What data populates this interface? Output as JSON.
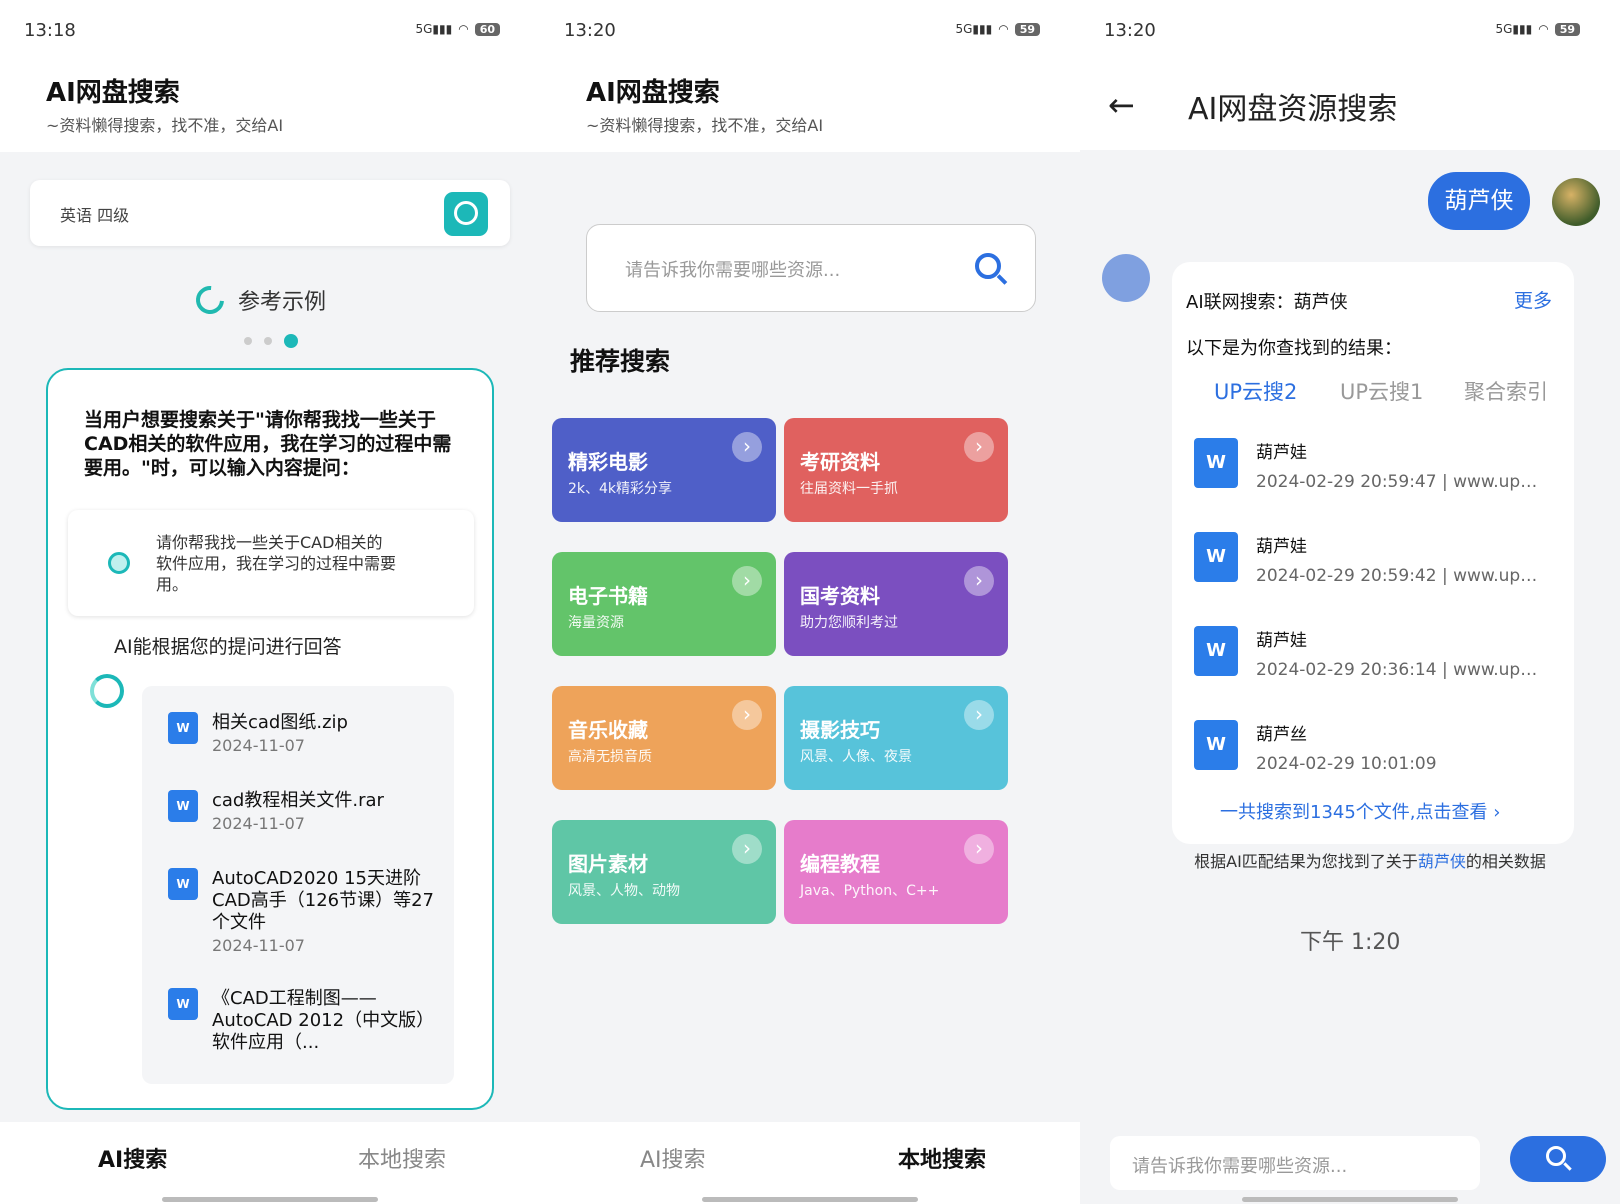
{
  "panel1": {
    "status_time": "13:18",
    "battery": "60",
    "app_title": "AI网盘搜索",
    "app_subtitle": "~资料懒得搜索，找不准，交给AI",
    "search_value": "英语 四级",
    "example_title": "参考示例",
    "intro": "当用户想要搜索关于\"请你帮我找一些关于CAD相关的软件应用，我在学习的过程中需要用。\"时，可以输入内容提问：",
    "prompt": "请你帮我找一些关于CAD相关的软件应用，我在学习的过程中需要用。",
    "ai_answer_label": "AI能根据您的提问进行回答",
    "files": [
      {
        "name": "相关cad图纸.zip",
        "date": "2024-11-07"
      },
      {
        "name": "cad教程相关文件.rar",
        "date": "2024-11-07"
      },
      {
        "name": "AutoCAD2020 15天进阶CAD高手（126节课）等27 个文件",
        "date": "2024-11-07"
      },
      {
        "name": "《CAD工程制图——AutoCAD 2012（中文版）软件应用（...",
        "date": ""
      }
    ],
    "tab_ai": "AI搜索",
    "tab_local": "本地搜索"
  },
  "panel2": {
    "status_time": "13:20",
    "battery": "59",
    "app_title": "AI网盘搜索",
    "app_subtitle": "~资料懒得搜索，找不准，交给AI",
    "search_placeholder": "请告诉我你需要哪些资源...",
    "rec_title": "推荐搜索",
    "tiles": [
      {
        "title": "精彩电影",
        "sub": "2k、4k精彩分享",
        "color": "#4f5fc8"
      },
      {
        "title": "考研资料",
        "sub": "往届资料一手抓",
        "color": "#e0615f"
      },
      {
        "title": "电子书籍",
        "sub": "海量资源",
        "color": "#63c46a"
      },
      {
        "title": "国考资料",
        "sub": "助力您顺利考过",
        "color": "#7b4fc0"
      },
      {
        "title": "音乐收藏",
        "sub": "高清无损音质",
        "color": "#eea35a"
      },
      {
        "title": "摄影技巧",
        "sub": "风景、人像、夜景",
        "color": "#57c3da"
      },
      {
        "title": "图片素材",
        "sub": "风景、人物、动物",
        "color": "#5fc6a6"
      },
      {
        "title": "编程教程",
        "sub": "Java、Python、C++",
        "color": "#e67ccb"
      }
    ],
    "tab_ai": "AI搜索",
    "tab_local": "本地搜索"
  },
  "panel3": {
    "status_time": "13:20",
    "battery": "59",
    "title": "AI网盘资源搜索",
    "user_query": "葫芦侠",
    "result_head": "AI联网搜索：葫芦侠",
    "more": "更多",
    "result_sub": "以下是为你查找到的结果：",
    "tabs": [
      "UP云搜2",
      "UP云搜1",
      "聚合索引"
    ],
    "results": [
      {
        "name": "葫芦娃",
        "meta": "2024-02-29 20:59:47 | www.upy···"
      },
      {
        "name": "葫芦娃",
        "meta": "2024-02-29 20:59:42 | www.upy···"
      },
      {
        "name": "葫芦娃",
        "meta": "2024-02-29 20:36:14 | www.upy···"
      },
      {
        "name": "葫芦丝",
        "meta": "2024-02-29 10:01:09"
      }
    ],
    "total": "一共搜索到1345个文件,点击查看 ›",
    "foot_pre": "根据AI匹配结果为您找到了关于",
    "foot_hl": "葫芦侠",
    "foot_post": "的相关数据",
    "chat_time": "下午 1:20",
    "input_placeholder": "请告诉我你需要哪些资源..."
  }
}
